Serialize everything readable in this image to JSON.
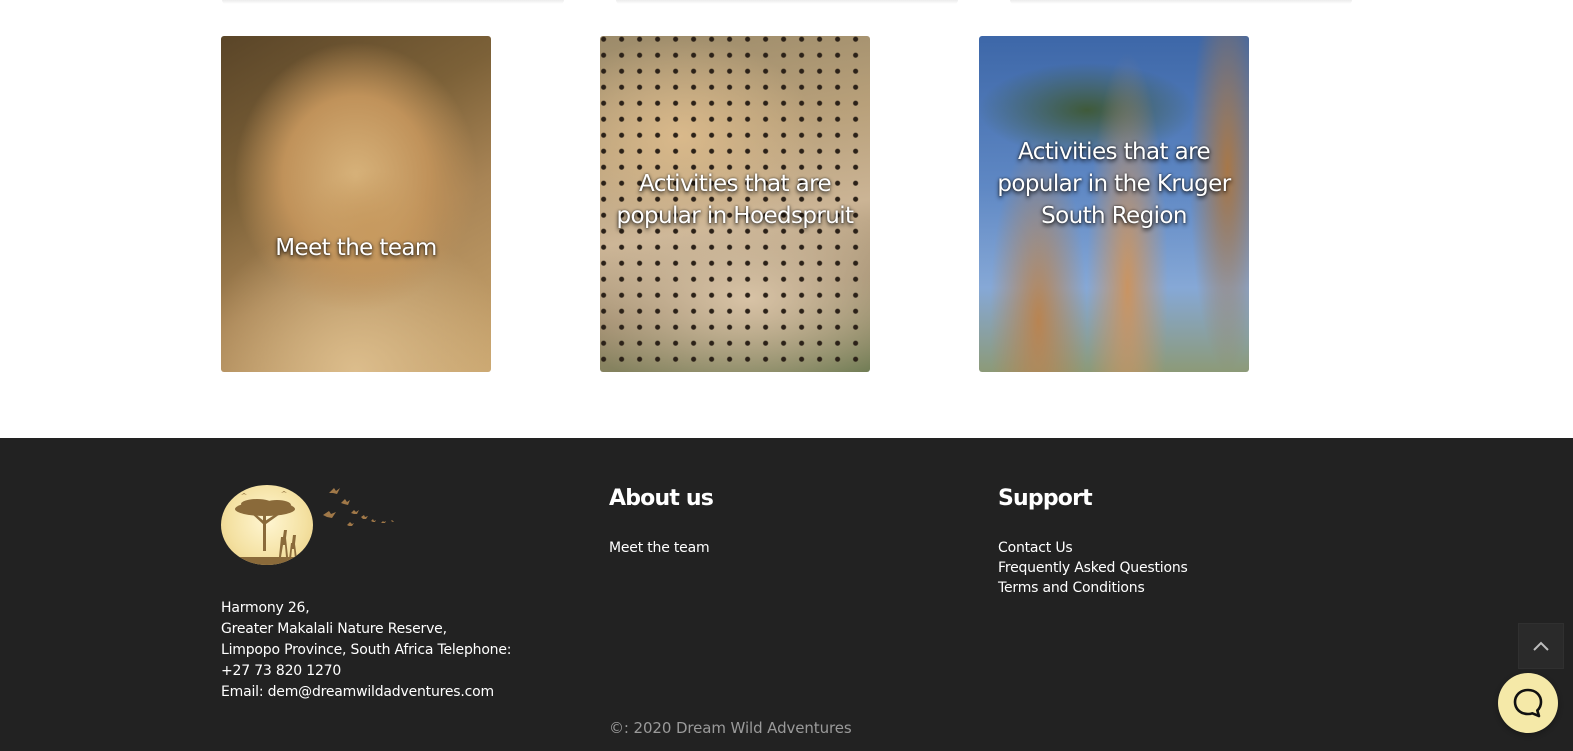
{
  "cards": [
    {
      "title": "Meet the team",
      "subject": "lioness"
    },
    {
      "title": "Activities that are popular in Hoedspruit",
      "subject": "cheetah"
    },
    {
      "title": "Activities that are popular in the Kruger South Region",
      "subject": "giraffes"
    }
  ],
  "footer": {
    "background_color": "#222222",
    "logo_icon": "acacia-tree-giraffe-moon-logo",
    "address_lines": [
      "Harmony 26,",
      "Greater Makalali Nature Reserve,",
      "Limpopo Province, South Africa Telephone:",
      "+27 73 820 1270"
    ],
    "email_prefix": "Email: ",
    "email": "dem@dreamwildadventures.com",
    "about": {
      "heading": "About us",
      "links": [
        "Meet the team"
      ]
    },
    "support": {
      "heading": "Support",
      "links": [
        "Contact Us",
        "Frequently Asked Questions",
        "Terms and Conditions"
      ]
    },
    "copyright": "©: 2020 Dream Wild Adventures"
  },
  "widgets": {
    "back_to_top_icon": "chevron-up-icon",
    "chat_icon": "chat-bubble-icon",
    "chat_color": "#f5e9a8"
  }
}
